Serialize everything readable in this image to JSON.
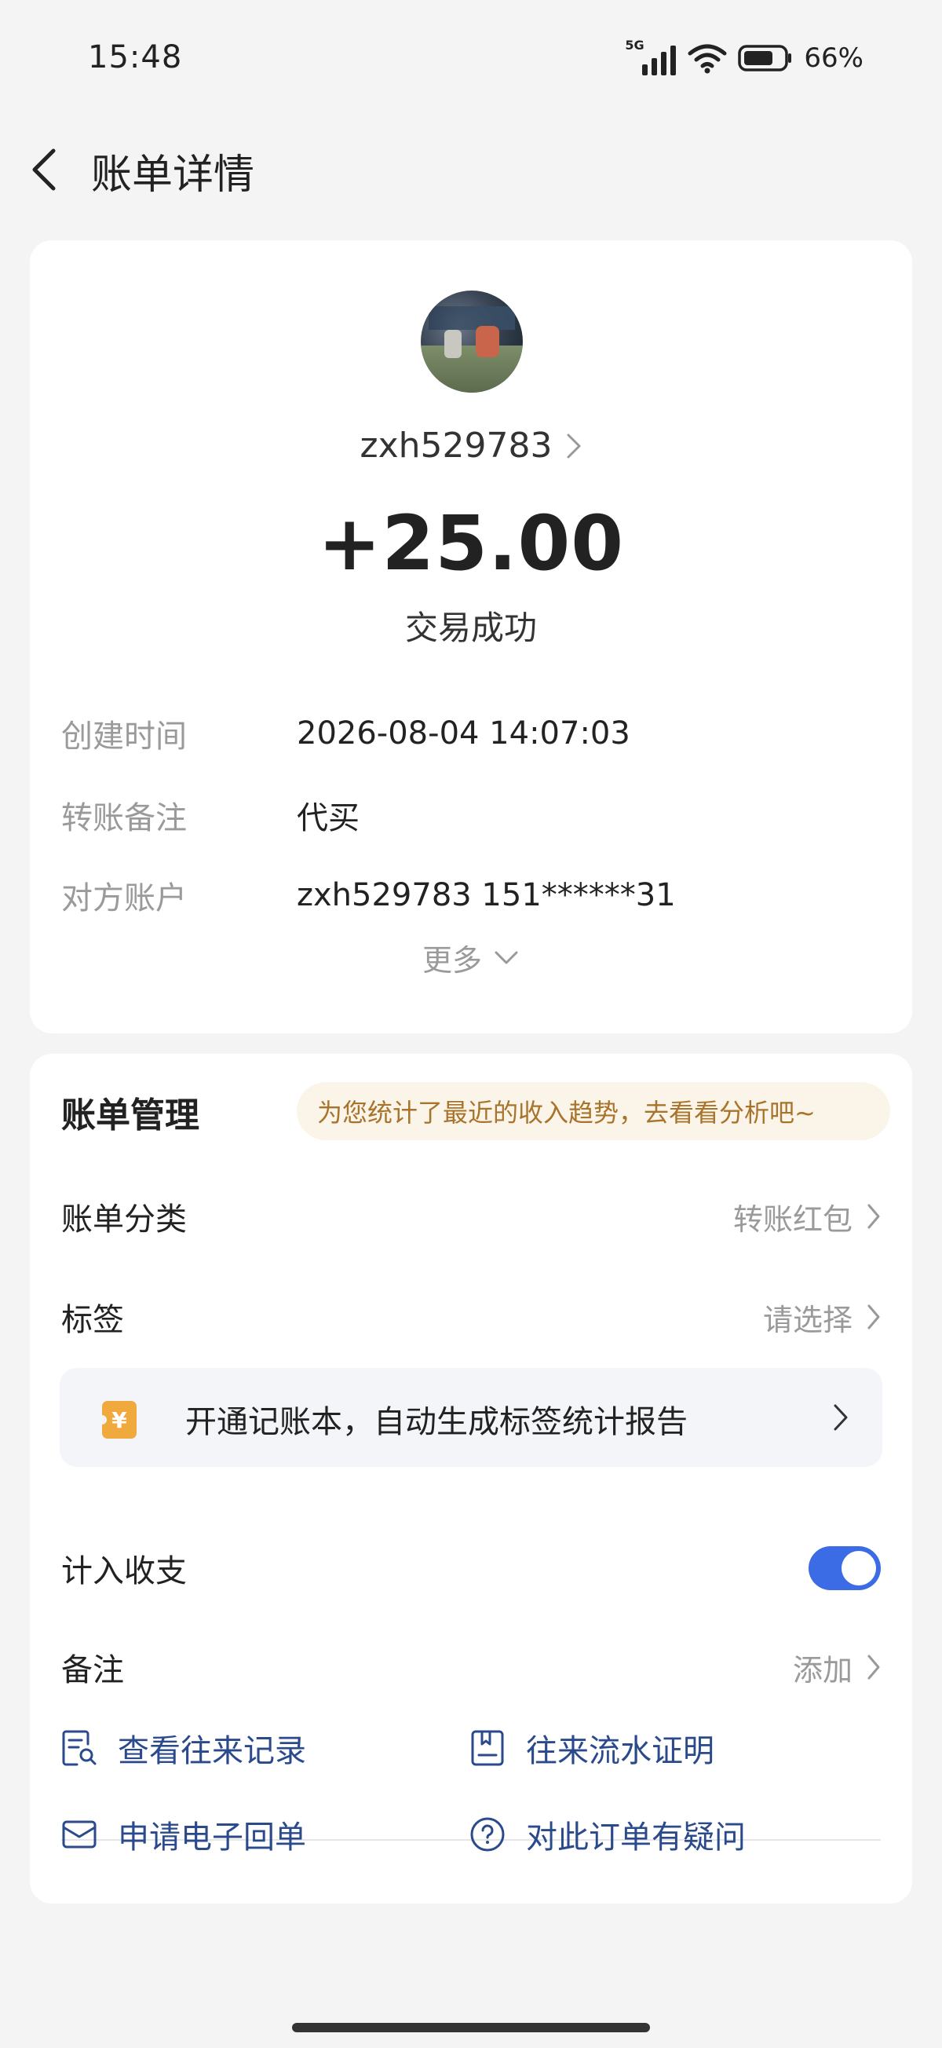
{
  "status_bar": {
    "time": "15:48",
    "network": "5G",
    "battery": "66%"
  },
  "header": {
    "title": "账单详情"
  },
  "transaction": {
    "username": "zxh529783",
    "amount": "+25.00",
    "status": "交易成功",
    "details": [
      {
        "label": "创建时间",
        "value": "2026-08-04 14:07:03"
      },
      {
        "label": "转账备注",
        "value": "代买"
      },
      {
        "label": "对方账户",
        "value": "zxh529783 151******31"
      }
    ],
    "more": "更多"
  },
  "management": {
    "title": "账单管理",
    "promo": "为您统计了最近的收入趋势，去看看分析吧~",
    "category": {
      "label": "账单分类",
      "value": "转账红包"
    },
    "tag": {
      "label": "标签",
      "value": "请选择"
    },
    "ledger_banner": "开通记账本，自动生成标签统计报告",
    "include": {
      "label": "计入收支",
      "enabled": true
    },
    "note": {
      "label": "备注",
      "value": "添加"
    }
  },
  "links": {
    "history": "查看往来记录",
    "statement": "往来流水证明",
    "receipt": "申请电子回单",
    "question": "对此订单有疑问"
  },
  "colors": {
    "accent": "#3b6ce6",
    "link": "#2a4a8c",
    "promo_text": "#a8742c",
    "promo_bg": "#fbf4e8",
    "ledger_icon": "#f0a93c"
  }
}
